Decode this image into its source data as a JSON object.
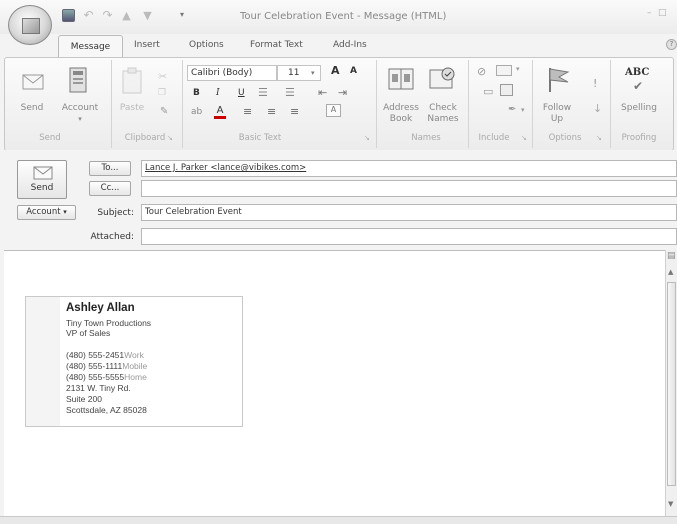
{
  "window": {
    "title": "Tour Celebration Event - Message (HTML)",
    "help": "?"
  },
  "tabs": [
    "Message",
    "Insert",
    "Options",
    "Format Text",
    "Add-Ins"
  ],
  "ribbon": {
    "send": {
      "label": "Send",
      "group": "Send"
    },
    "account": {
      "label": "Account",
      "arrow": "▾"
    },
    "paste": {
      "label": "Paste"
    },
    "clipboard": {
      "group": "Clipboard"
    },
    "font_name": "Calibri (Body)",
    "font_size": "11",
    "font_grow": "A",
    "font_shrink": "A",
    "bold": "B",
    "italic": "I",
    "underline": "U",
    "basic_text": {
      "group": "Basic Text"
    },
    "address_book": {
      "line1": "Address",
      "line2": "Book"
    },
    "check_names": {
      "line1": "Check",
      "line2": "Names"
    },
    "names": {
      "group": "Names"
    },
    "include": {
      "group": "Include"
    },
    "follow_up": {
      "line1": "Follow",
      "line2": "Up"
    },
    "options": {
      "group": "Options"
    },
    "spelling": {
      "label": "Spelling",
      "abc": "ABC"
    },
    "proofing": {
      "group": "Proofing"
    }
  },
  "compose": {
    "send_label": "Send",
    "to_label": "To...",
    "to_value": "Lance J. Parker <lance@vibikes.com>",
    "cc_label": "Cc...",
    "cc_value": "",
    "account_label": "Account",
    "subject_label": "Subject:",
    "subject_value": "Tour Celebration Event",
    "attached_label": "Attached:",
    "attached_value": ""
  },
  "card": {
    "name": "Ashley Allan",
    "company": "Tiny Town Productions",
    "title": "VP of Sales",
    "phones": [
      {
        "number": "(480) 555-2451",
        "type": "Work"
      },
      {
        "number": "(480) 555-1111",
        "type": "Mobile"
      },
      {
        "number": "(480) 555-5555",
        "type": "Home"
      }
    ],
    "address1": "2131 W. Tiny Rd.",
    "address2": "Suite 200",
    "city_state_zip": "Scottsdale, AZ  85028"
  }
}
